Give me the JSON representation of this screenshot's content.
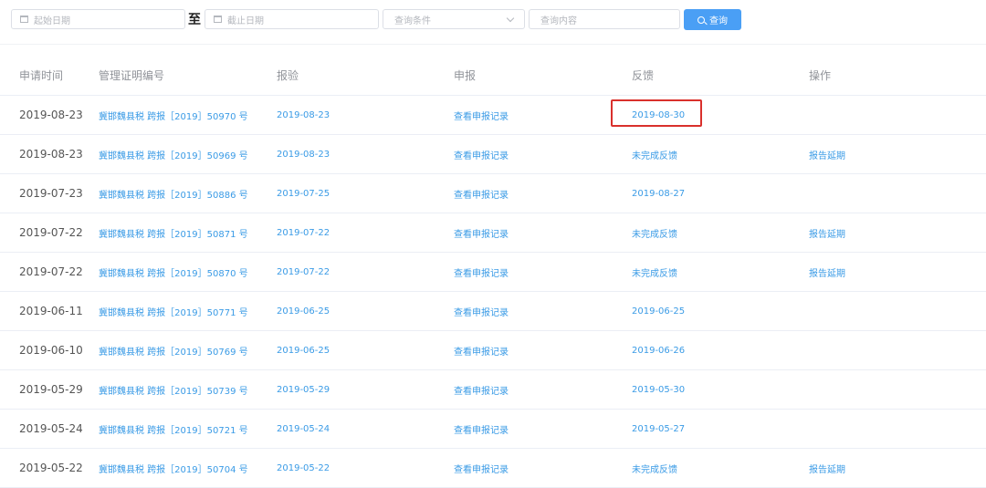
{
  "filters": {
    "start_date_placeholder": "起始日期",
    "separator": "至",
    "end_date_placeholder": "截止日期",
    "condition_placeholder": "查询条件",
    "content_placeholder": "查询内容",
    "search_label": "查询"
  },
  "table": {
    "headers": [
      "申请时间",
      "管理证明编号",
      "报验",
      "申报",
      "反馈",
      "操作"
    ],
    "rows": [
      {
        "apply_date": "2019-08-23",
        "cert_no": "冀邯魏县税 跨报［2019］50970 号",
        "inspection": "2019-08-23",
        "declare": "查看申报记录",
        "feedback": "2019-08-30",
        "action": ""
      },
      {
        "apply_date": "2019-08-23",
        "cert_no": "冀邯魏县税 跨报［2019］50969 号",
        "inspection": "2019-08-23",
        "declare": "查看申报记录",
        "feedback": "未完成反馈",
        "action": "报告延期"
      },
      {
        "apply_date": "2019-07-23",
        "cert_no": "冀邯魏县税 跨报［2019］50886 号",
        "inspection": "2019-07-25",
        "declare": "查看申报记录",
        "feedback": "2019-08-27",
        "action": ""
      },
      {
        "apply_date": "2019-07-22",
        "cert_no": "冀邯魏县税 跨报［2019］50871 号",
        "inspection": "2019-07-22",
        "declare": "查看申报记录",
        "feedback": "未完成反馈",
        "action": "报告延期"
      },
      {
        "apply_date": "2019-07-22",
        "cert_no": "冀邯魏县税 跨报［2019］50870 号",
        "inspection": "2019-07-22",
        "declare": "查看申报记录",
        "feedback": "未完成反馈",
        "action": "报告延期"
      },
      {
        "apply_date": "2019-06-11",
        "cert_no": "冀邯魏县税 跨报［2019］50771 号",
        "inspection": "2019-06-25",
        "declare": "查看申报记录",
        "feedback": "2019-06-25",
        "action": ""
      },
      {
        "apply_date": "2019-06-10",
        "cert_no": "冀邯魏县税 跨报［2019］50769 号",
        "inspection": "2019-06-25",
        "declare": "查看申报记录",
        "feedback": "2019-06-26",
        "action": ""
      },
      {
        "apply_date": "2019-05-29",
        "cert_no": "冀邯魏县税 跨报［2019］50739 号",
        "inspection": "2019-05-29",
        "declare": "查看申报记录",
        "feedback": "2019-05-30",
        "action": ""
      },
      {
        "apply_date": "2019-05-24",
        "cert_no": "冀邯魏县税 跨报［2019］50721 号",
        "inspection": "2019-05-24",
        "declare": "查看申报记录",
        "feedback": "2019-05-27",
        "action": ""
      },
      {
        "apply_date": "2019-05-22",
        "cert_no": "冀邯魏县税 跨报［2019］50704 号",
        "inspection": "2019-05-22",
        "declare": "查看申报记录",
        "feedback": "未完成反馈",
        "action": "报告延期"
      }
    ]
  },
  "colors": {
    "accent": "#4a9ff5",
    "link": "#3a9be6",
    "highlight": "#d9302c"
  }
}
